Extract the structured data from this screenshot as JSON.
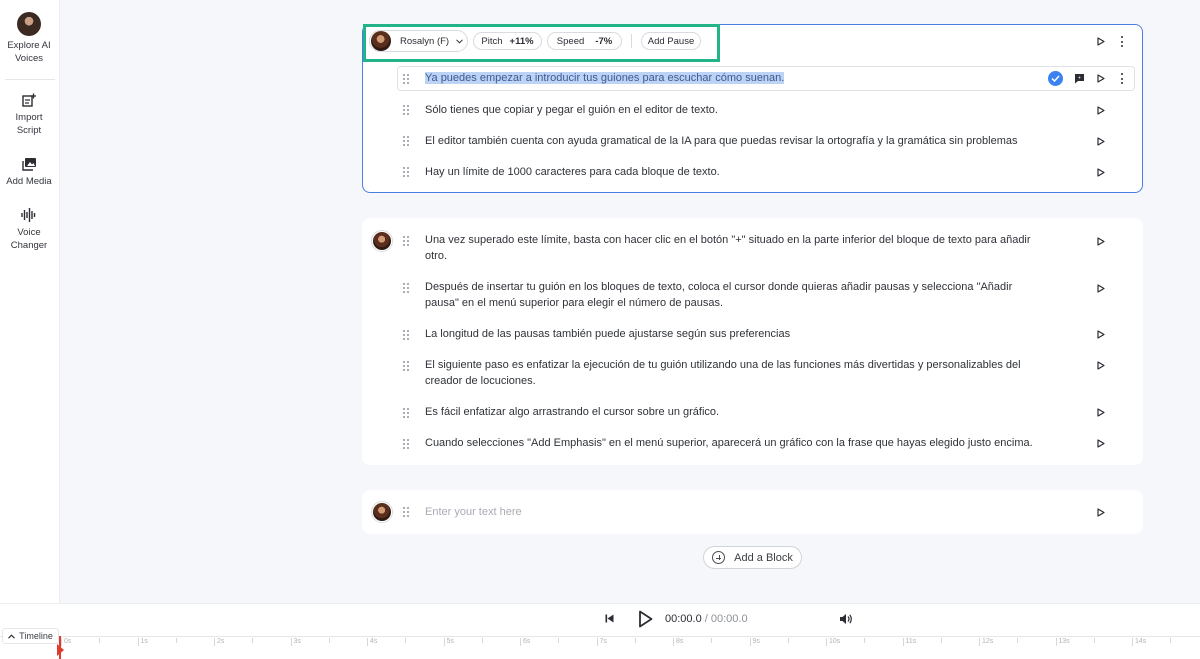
{
  "sidebar": {
    "items": [
      {
        "label": "Explore AI Voices",
        "icon": "avatar"
      },
      {
        "label": "Import Script",
        "icon": "import-icon"
      },
      {
        "label": "Add Media",
        "icon": "media-icon"
      },
      {
        "label": "Voice Changer",
        "icon": "waveform-icon"
      }
    ]
  },
  "toolbar": {
    "voice": "Rosalyn (F)",
    "pitch_label": "Pitch",
    "pitch_value": "+11%",
    "speed_label": "Speed",
    "speed_value": "-7%",
    "pause_label": "Add Pause"
  },
  "blocks": [
    {
      "lines": [
        "Ya puedes empezar a introducir tus guiones para escuchar cómo suenan.",
        "Sólo tienes que copiar y pegar el guión en el editor de texto.",
        "El editor también cuenta con ayuda gramatical de la IA para que puedas revisar la ortografía y la gramática sin problemas",
        "Hay un límite de 1000 caracteres para cada bloque de texto."
      ]
    },
    {
      "lines": [
        "Una vez superado este límite, basta con hacer clic en el botón \"+\" situado en la parte inferior del bloque de texto para añadir",
        "otro.",
        "Después de insertar tu guión en los bloques de texto, coloca el cursor donde quieras añadir pausas y selecciona \"Añadir",
        "pausa\" en el menú superior para elegir el número de pausas.",
        "La longitud de las pausas también puede ajustarse según sus preferencias",
        "El siguiente paso es enfatizar la ejecución de tu guión utilizando una de las funciones más divertidas y personalizables del",
        "creador de locuciones.",
        "Es fácil enfatizar algo arrastrando el cursor sobre un gráfico.",
        "Cuando selecciones \"Add Emphasis\" en el menú superior, aparecerá un gráfico con la frase que hayas elegido justo encima."
      ]
    },
    {
      "placeholder": "Enter your text here"
    }
  ],
  "add_block_label": "Add a Block",
  "player": {
    "current": "00:00.0",
    "separator": "/",
    "total": "00:00.0"
  },
  "timeline": {
    "label": "Timeline",
    "ticks": [
      "0s",
      "1s",
      "2s",
      "3s",
      "4s",
      "5s",
      "6s",
      "7s",
      "8s",
      "9s",
      "10s",
      "11s",
      "12s",
      "13s",
      "14s"
    ]
  },
  "colors": {
    "accent": "#4a7fe0",
    "highlight_box": "#23b388",
    "selection": "#bcd3f5",
    "playhead": "#e03b2d"
  }
}
